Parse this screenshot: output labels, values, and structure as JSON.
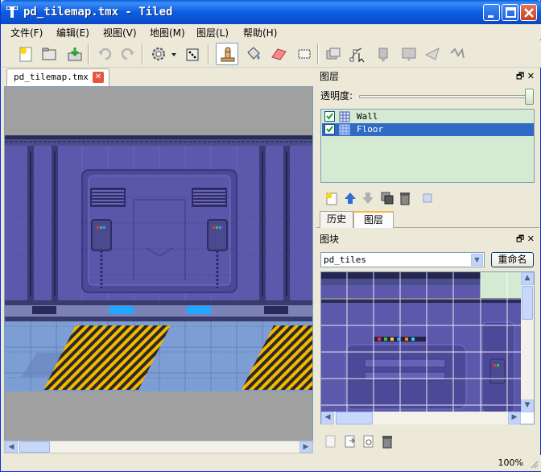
{
  "window": {
    "title": "pd_tilemap.tmx - Tiled"
  },
  "menu": [
    "文件(F)",
    "编辑(E)",
    "视图(V)",
    "地图(M)",
    "图层(L)",
    "帮助(H)"
  ],
  "toolbar": {
    "tools": [
      "new-icon",
      "open-icon",
      "save-icon",
      "undo-icon",
      "redo-icon",
      "settings-icon",
      "random-icon",
      "stamp-icon",
      "bucket-fill-icon",
      "eraser-icon",
      "rectangle-select-icon",
      "select-objects-icon",
      "edit-polygons-icon",
      "insert-rectangle-icon",
      "insert-image-icon",
      "insert-polygon-icon",
      "insert-polyline-icon"
    ]
  },
  "document": {
    "tab_label": "pd_tilemap.tmx"
  },
  "layers_dock": {
    "title": "图层",
    "opacity_label": "透明度:",
    "opacity": 1.0,
    "layers": [
      {
        "name": "Wall",
        "visible": true,
        "selected": false
      },
      {
        "name": "Floor",
        "visible": true,
        "selected": true
      }
    ],
    "tabs": [
      "历史",
      "图层"
    ],
    "active_tab": "图层"
  },
  "tileset_dock": {
    "title": "图块",
    "tileset": "pd_tiles",
    "rename_label": "重命名"
  },
  "status": {
    "zoom": "100%"
  },
  "colors": {
    "title_bar": "#0b50d0",
    "selection": "#316ac5",
    "layer_list_bg": "#d4ead2",
    "map_wall": "#5a58a8",
    "map_floor": "#7b9ad0"
  }
}
